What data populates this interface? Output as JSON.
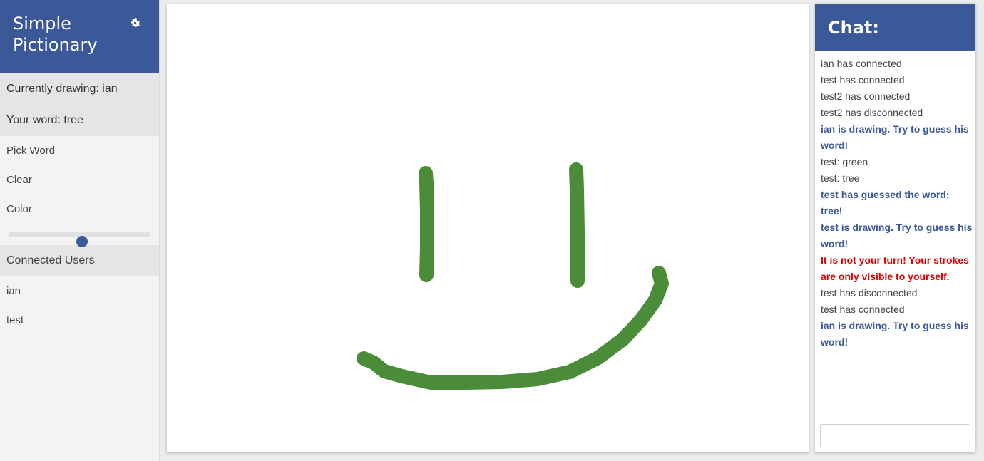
{
  "app": {
    "title": "Simple Pictionary",
    "settings_icon": "gear-icon"
  },
  "status": {
    "currently_drawing": "Currently drawing: ian",
    "your_word": "Your word: tree"
  },
  "menu": {
    "pick_word": "Pick Word",
    "clear": "Clear",
    "color": "Color"
  },
  "color_slider": {
    "value_fraction": 0.52
  },
  "users": {
    "heading": "Connected Users",
    "list": [
      "ian",
      "test"
    ]
  },
  "canvas": {
    "stroke_color": "#4a8c38"
  },
  "chat": {
    "title": "Chat:",
    "input_placeholder": "",
    "messages": [
      {
        "text": "ian has connected",
        "kind": "normal"
      },
      {
        "text": "test has connected",
        "kind": "normal"
      },
      {
        "text": "test2 has connected",
        "kind": "normal"
      },
      {
        "text": "test2 has disconnected",
        "kind": "normal"
      },
      {
        "text": "ian is drawing. Try to guess his word!",
        "kind": "system"
      },
      {
        "text": "test: green",
        "kind": "normal"
      },
      {
        "text": "test: tree",
        "kind": "normal"
      },
      {
        "text": "test has guessed the word: tree!",
        "kind": "system"
      },
      {
        "text": "test is drawing. Try to guess his word!",
        "kind": "system"
      },
      {
        "text": "It is not your turn! Your strokes are only visible to yourself.",
        "kind": "error"
      },
      {
        "text": "test has disconnected",
        "kind": "normal"
      },
      {
        "text": "test has connected",
        "kind": "normal"
      },
      {
        "text": "ian is drawing. Try to guess his word!",
        "kind": "system"
      }
    ]
  },
  "colors": {
    "accent": "#3b5998",
    "error": "#dd0000",
    "stroke": "#4a8c38"
  }
}
